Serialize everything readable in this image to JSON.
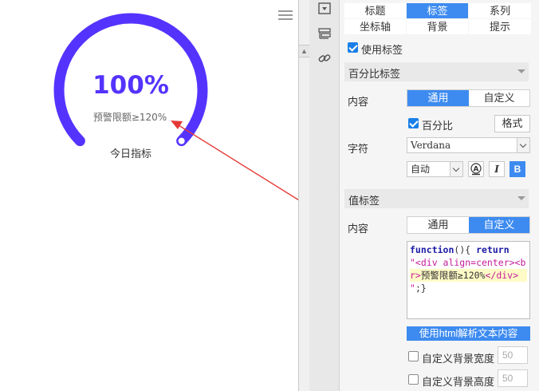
{
  "gauge": {
    "value_text": "100%",
    "warning_text": "预警限额≥120%",
    "name": "今日指标",
    "ring_color": "#5533ff",
    "value_color": "#5533ff"
  },
  "panel": {
    "tabs": [
      {
        "label": "标题",
        "active": false
      },
      {
        "label": "标签",
        "active": true
      },
      {
        "label": "系列",
        "active": false
      },
      {
        "label": "坐标轴",
        "active": false
      },
      {
        "label": "背景",
        "active": false
      },
      {
        "label": "提示",
        "active": false
      }
    ],
    "use_label": {
      "label": "使用标签",
      "checked": true
    },
    "percent_section": {
      "title": "百分比标签",
      "content_label": "内容",
      "content_options": [
        "通用",
        "自定义"
      ],
      "content_selected": "通用",
      "percent_checkbox": {
        "label": "百分比",
        "checked": true
      },
      "format_button": "格式",
      "font_label": "字符",
      "font_value": "Verdana",
      "size_value": "自动"
    },
    "value_section": {
      "title": "值标签",
      "content_label": "内容",
      "content_options": [
        "通用",
        "自定义"
      ],
      "content_selected": "自定义",
      "code_lines": [
        [
          {
            "t": "function",
            "c": "kw"
          },
          {
            "t": "(){ ",
            "c": ""
          },
          {
            "t": "return",
            "c": "kw"
          }
        ],
        [
          {
            "t": "\"<div align=center><b",
            "c": "str"
          }
        ],
        [
          {
            "t": "r>",
            "c": "str"
          },
          {
            "t": "预警限额≥120%",
            "c": ""
          },
          {
            "t": "</div>",
            "c": "str"
          }
        ],
        [
          {
            "t": "\"",
            "c": "str"
          },
          {
            "t": ";}",
            "c": ""
          }
        ]
      ],
      "html_parse_button": "使用html解析文本内容",
      "custom_bg_width": {
        "label": "自定义背景宽度",
        "checked": false,
        "value": "50"
      },
      "custom_bg_height": {
        "label": "自定义背景高度",
        "checked": false,
        "value": "50"
      }
    }
  }
}
